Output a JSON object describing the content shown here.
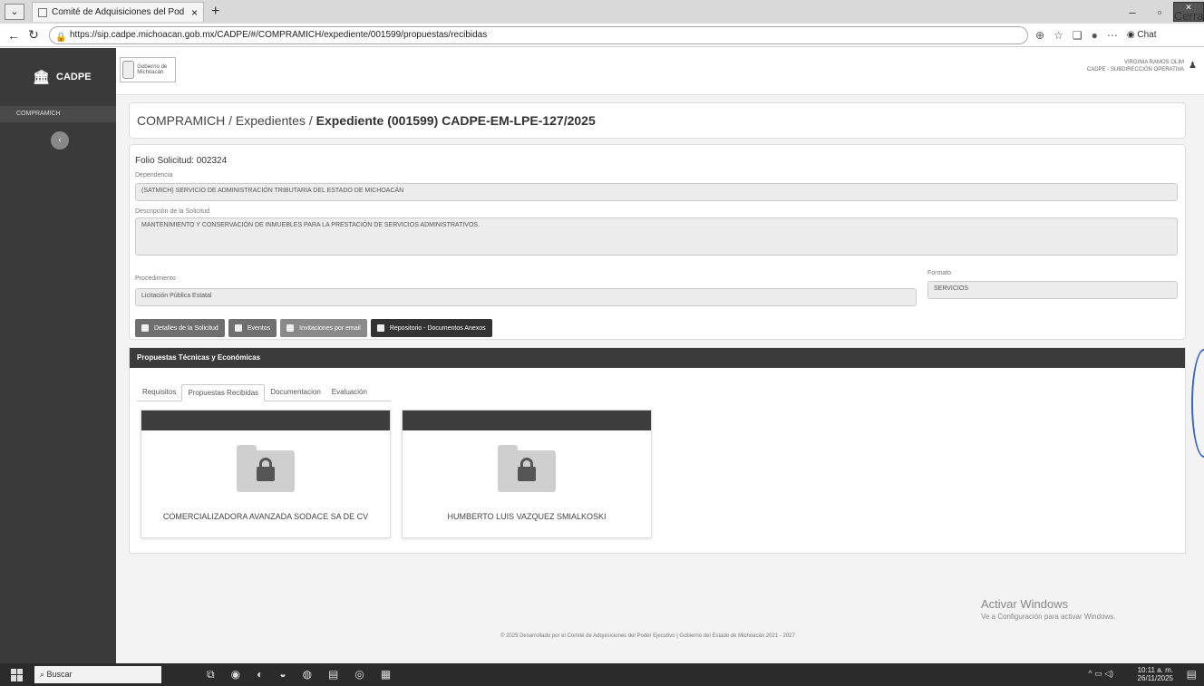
{
  "browser": {
    "tab_title": "Comité de Adquisiciones del Pod",
    "url": "https://sip.cadpe.michoacan.gob.mx/CADPE/#/COMPRAMICH/expediente/001599/propuestas/recibidas",
    "close_label": "Cerrar",
    "chat_label": "Chat"
  },
  "sidebar": {
    "brand": "CADPE",
    "items": [
      {
        "label": "COMPRAMICH"
      }
    ]
  },
  "header": {
    "logo_text": "Gobierno de Michoacán",
    "user_name": "VIRGINIA RAMOS OLIM",
    "user_role": "CADPE - SUBDIRECCIÓN OPERATIVA"
  },
  "breadcrumb": {
    "prefix": "COMPRAMICH / Expedientes / ",
    "current": "Expediente (001599) CADPE-EM-LPE-127/2025"
  },
  "solicitud": {
    "folio": "Folio Solicitud: 002324",
    "dependencia_label": "Dependencia",
    "dependencia": "(SATMICH) SERVICIO DE ADMINISTRACIÓN TRIBUTARIA DEL ESTADO DE MICHOACÁN",
    "descripcion_label": "Descripción de la Solicitud",
    "descripcion": "MANTENIMIENTO Y CONSERVACIÓN DE INMUEBLES PARA LA PRESTACIÓN DE SERVICIOS ADMINISTRATIVOS.",
    "procedimiento_label": "Procedimiento",
    "procedimiento": "Licitación Pública Estatal",
    "formato_label": "Formato",
    "formato": "SERVICIOS"
  },
  "buttons": {
    "detalles": "Detalles de la Solicitud",
    "eventos": "Eventos",
    "invitaciones": "Invitaciones por email",
    "repositorio": "Repositorio - Documentos Anexos"
  },
  "propuestas": {
    "title": "Propuestas Técnicas y Económicas",
    "tabs": [
      "Requisitos",
      "Propuestas Recibidas",
      "Documentacion",
      "Evaluación"
    ],
    "proveedores": [
      "COMERCIALIZADORA AVANZADA SODACE SA DE CV",
      "HUMBERTO LUIS VAZQUEZ SMIALKOSKI"
    ]
  },
  "windows": {
    "activate_title": "Activar Windows",
    "activate_sub": "Ve a Configuración para activar Windows.",
    "search": "Buscar",
    "time": "10:11 a. m.",
    "date": "26/11/2025"
  },
  "footer": "© 2025 Desarrollado por el Comité de Adquisiciones del Poder Ejecutivo | Gobierno del Estado de Michoacán 2021 - 2027"
}
